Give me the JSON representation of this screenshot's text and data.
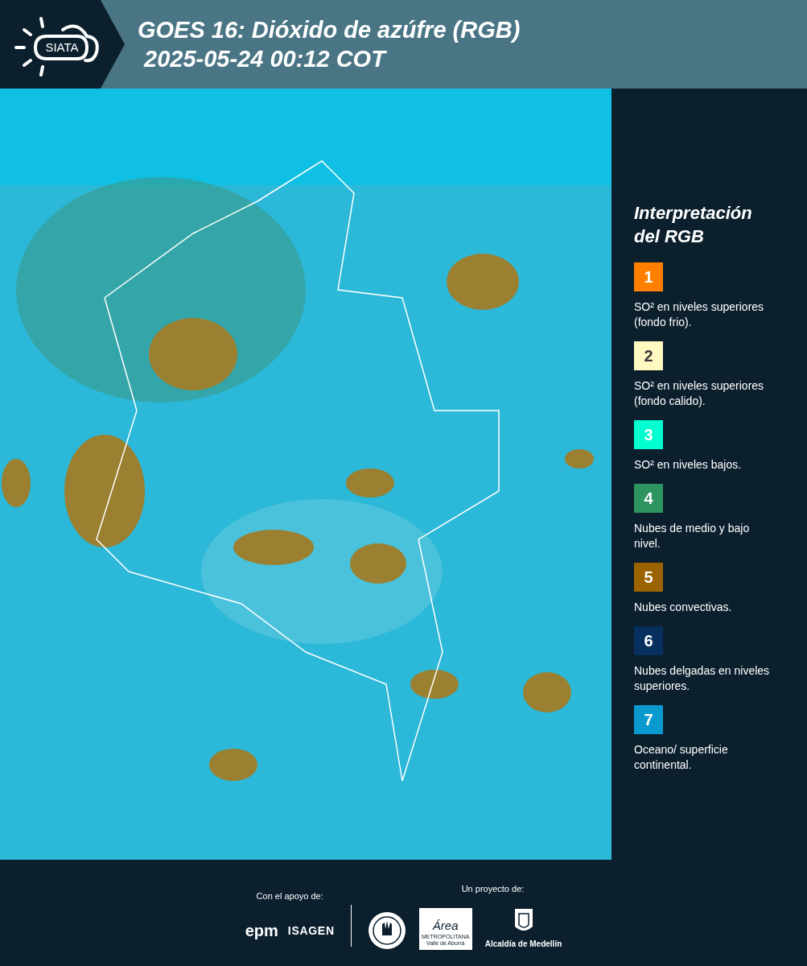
{
  "header": {
    "logo": "SIATA",
    "title": "GOES 16: Dióxido de azúfre (RGB)",
    "timestamp": "2025-05-24 00:12 COT"
  },
  "legend": {
    "title": "Interpretación del RGB",
    "items": [
      {
        "number": "1",
        "color": "#ff7f00",
        "text": "SO² en niveles superiores (fondo frio)."
      },
      {
        "number": "2",
        "color": "#fff8c0",
        "text": "SO² en niveles superiores (fondo calido)."
      },
      {
        "number": "3",
        "color": "#00ffd0",
        "text": "SO² en niveles bajos."
      },
      {
        "number": "4",
        "color": "#2e9460",
        "text": "Nubes de medio y bajo nivel."
      },
      {
        "number": "5",
        "color": "#9c6400",
        "text": "Nubes convectivas."
      },
      {
        "number": "6",
        "color": "#08305e",
        "text": "Nubes delgadas en niveles superiores."
      },
      {
        "number": "7",
        "color": "#0899cf",
        "text": "Oceano/ superficie continental."
      }
    ]
  },
  "footer": {
    "support_label": "Con el apoyo de:",
    "supporters": [
      "epm",
      "ISAGEN"
    ],
    "project_label": "Un proyecto de:",
    "area_logo": {
      "name": "Área",
      "line1": "METROPOLITANA",
      "line2": "Valle de Aburrá"
    },
    "alcaldia": "Alcaldía de Medellín"
  }
}
